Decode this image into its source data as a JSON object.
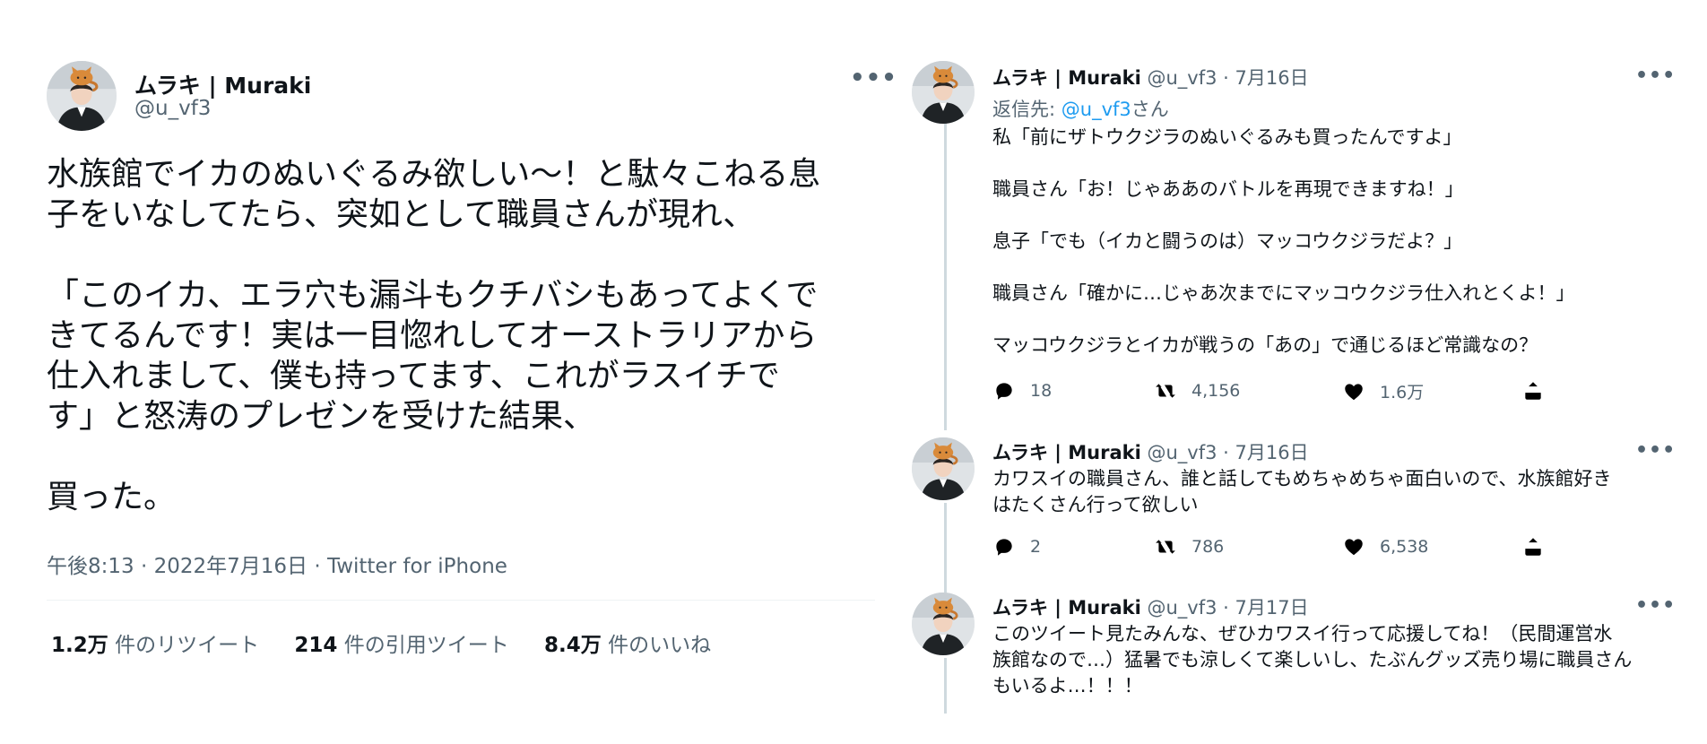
{
  "main_tweet": {
    "name": "ムラキ | Muraki",
    "handle": "@u_vf3",
    "more_icon": "more-icon",
    "text_lines": [
      "水族館でイカのぬいぐるみ欲しい〜！と駄々こねる息",
      "子をいなしてたら、突如として職員さんが現れ、",
      "「このイカ、エラ穴も漏斗もクチバシもあってよくで",
      "きてるんです！実は一目惚れしてオーストラリアから",
      "仕入れまして、僕も持ってます、これがラスイチで",
      "す」と怒涛のプレゼンを受けた結果、",
      "買った。"
    ],
    "meta": "午後8:13 · 2022年7月16日 · Twitter for iPhone",
    "stats": {
      "retweets_count": "1.2万",
      "retweets_label": "件のリツイート",
      "quotes_count": "214",
      "quotes_label": "件の引用ツイート",
      "likes_count": "8.4万",
      "likes_label": "件のいいね"
    }
  },
  "replies": [
    {
      "name": "ムラキ | Muraki",
      "handle_date": "@u_vf3 · 7月16日",
      "reply_to_label": "返信先: ",
      "reply_to_handle": "@u_vf3",
      "reply_to_suffix": "さん",
      "text": [
        "私「前にザトウクジラのぬいぐるみも買ったんですよ」",
        "職員さん「お！じゃああのバトルを再現できますね！」",
        "息子「でも（イカと闘うのは）マッコウクジラだよ？」",
        "職員さん「確かに…じゃあ次までにマッコウクジラ仕入れとくよ！」",
        "マッコウクジラとイカが戦うの「あの」で通じるほど常識なの？"
      ],
      "replies": "18",
      "retweets": "4,156",
      "likes": "1.6万"
    },
    {
      "name": "ムラキ | Muraki",
      "handle_date": "@u_vf3 · 7月16日",
      "text": [
        "カワスイの職員さん、誰と話してもめちゃめちゃ面白いので、水族館好き",
        "はたくさん行って欲しい"
      ],
      "replies": "2",
      "retweets": "786",
      "likes": "6,538"
    },
    {
      "name": "ムラキ | Muraki",
      "handle_date": "@u_vf3 · 7月17日",
      "text": [
        "このツイート見たみんな、ぜひカワスイ行って応援してね！（民間運営水",
        "族館なので…）猛暑でも涼しくて楽しいし、たぶんグッズ売り場に職員さん",
        "もいるよ…！！！"
      ]
    }
  ],
  "icons": {
    "reply": "reply-icon",
    "retweet": "retweet-icon",
    "like": "heart-icon",
    "share": "share-icon",
    "more": "more-icon",
    "avatar": "avatar"
  },
  "colors": {
    "text": "#0f1419",
    "secondary": "#536471",
    "link": "#1d9bf0",
    "thread_line": "#cfd9de",
    "separator": "#eff3f4"
  }
}
